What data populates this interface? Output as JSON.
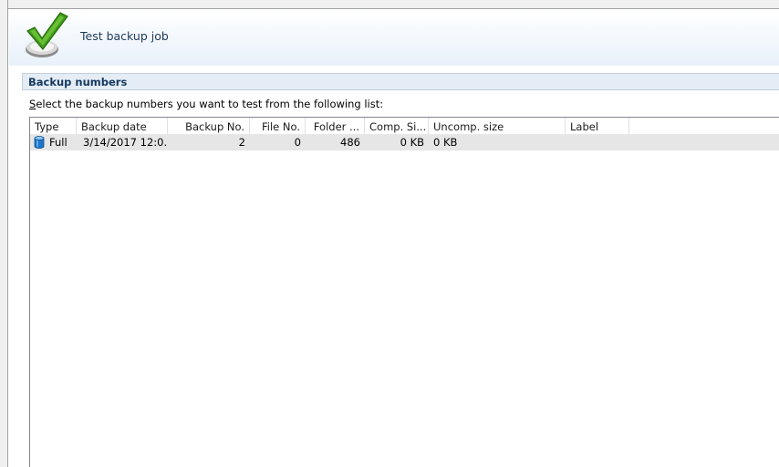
{
  "header": {
    "title": "Test backup job"
  },
  "section": {
    "title": "Backup numbers"
  },
  "instruction": {
    "text": "Select the backup numbers you want to test from the following list:"
  },
  "table": {
    "columns": [
      "Type",
      "Backup date",
      "Backup No.",
      "File No.",
      "Folder ...",
      "Comp. Si...",
      "Uncomp. size",
      "Label"
    ],
    "rows": [
      {
        "type": "Full",
        "backup_date": "3/14/2017 12:0...",
        "backup_no": "2",
        "file_no": "0",
        "folder": "486",
        "comp_size": "0 KB",
        "uncomp_size": "0 KB",
        "label": ""
      }
    ]
  },
  "icons": {
    "header": "green-checkmark-icon",
    "row_type": "database-icon"
  },
  "colors": {
    "section_bar": "#e4ecf5",
    "selected_row": "#e6e6e6",
    "title_text": "#14395e"
  }
}
